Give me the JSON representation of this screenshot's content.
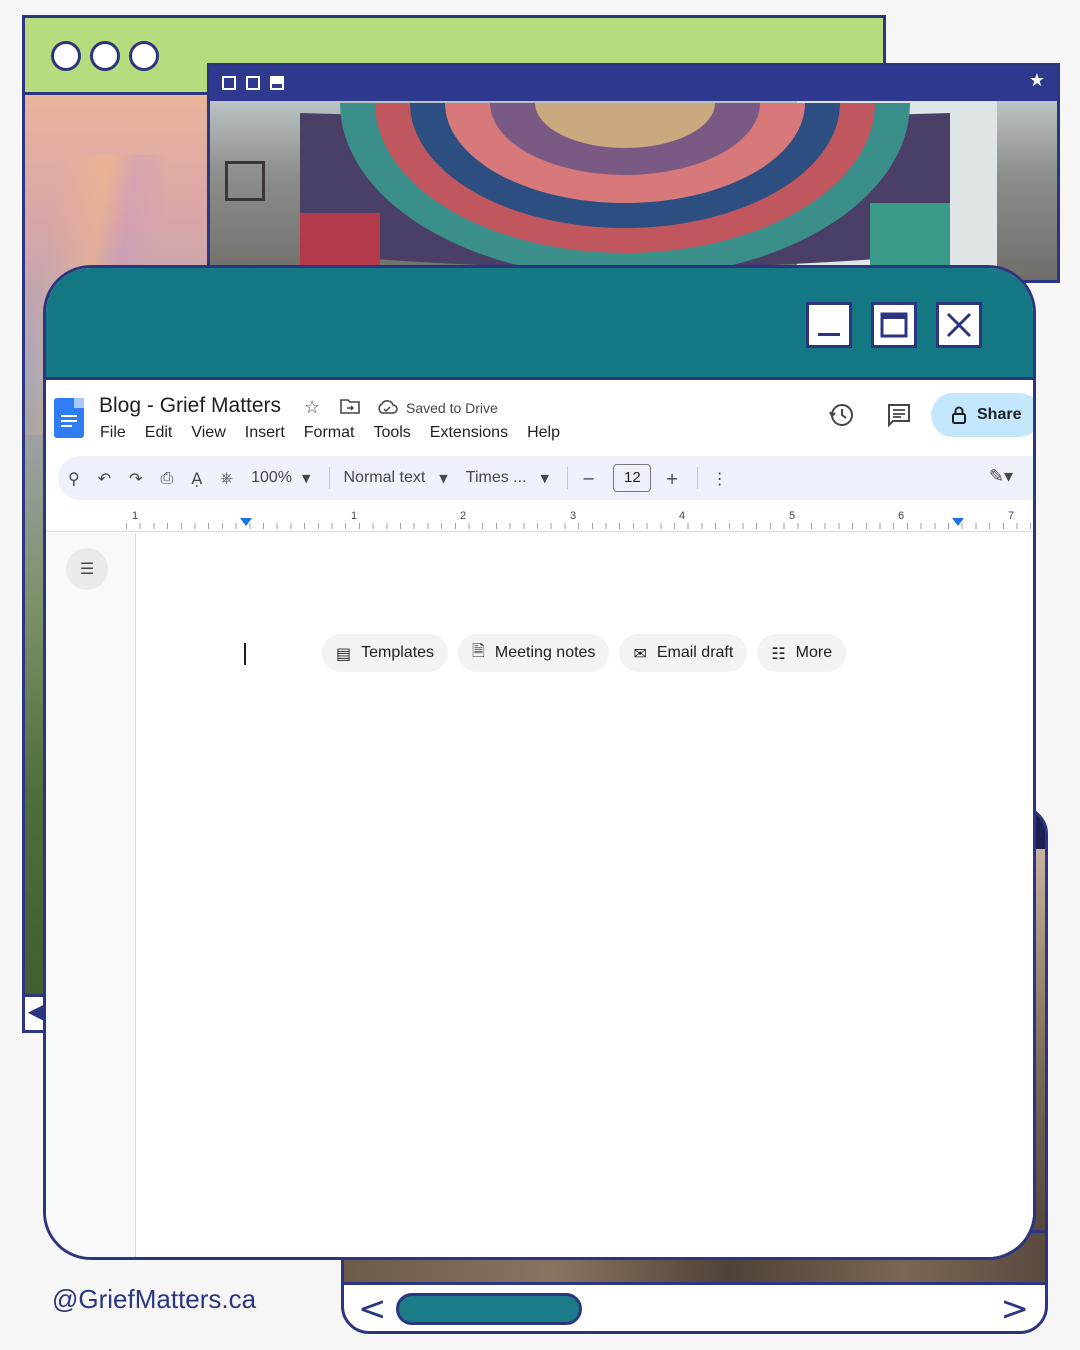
{
  "doc": {
    "title": "Blog - Grief Matters",
    "saved_status": "Saved to Drive",
    "menu": [
      "File",
      "Edit",
      "View",
      "Insert",
      "Format",
      "Tools",
      "Extensions",
      "Help"
    ],
    "share_label": "Share"
  },
  "toolbar": {
    "zoom": "100%",
    "style": "Normal text",
    "font": "Times ...",
    "font_size": "12"
  },
  "ruler": {
    "numbers": [
      "1",
      "1",
      "2",
      "3",
      "4",
      "5",
      "6",
      "7"
    ]
  },
  "chips": [
    {
      "label": "Templates",
      "icon": "template-icon"
    },
    {
      "label": "Meeting notes",
      "icon": "document-icon"
    },
    {
      "label": "Email draft",
      "icon": "email-icon"
    },
    {
      "label": "More",
      "icon": "more-doc-icon"
    }
  ],
  "footer": {
    "handle": "@GriefMatters.ca"
  },
  "colors": {
    "teal": "#147884",
    "navy": "#2b3580",
    "green": "#b7dc7d",
    "share_bg": "#c2e7ff"
  }
}
